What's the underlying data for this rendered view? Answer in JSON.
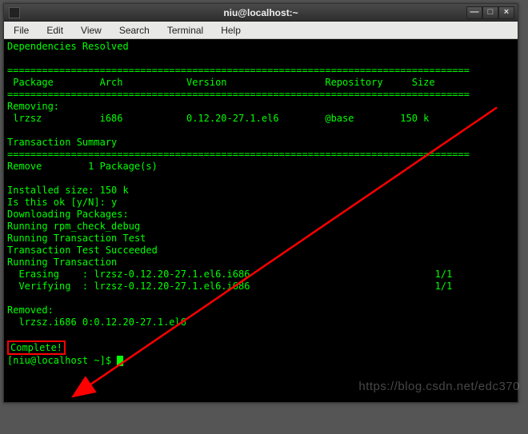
{
  "window": {
    "title": "niu@localhost:~",
    "controls": {
      "min": "—",
      "max": "□",
      "close": "×"
    }
  },
  "menu": {
    "file": "File",
    "edit": "Edit",
    "view": "View",
    "search": "Search",
    "terminal": "Terminal",
    "help": "Help"
  },
  "term": {
    "dep_resolved": "Dependencies Resolved",
    "hdr": " Package        Arch           Version                 Repository     Size",
    "removing": "Removing:",
    "pkg_row": " lrzsz          i686           0.12.20-27.1.el6        @base        150 k",
    "txn_summary": "Transaction Summary",
    "remove_count": "Remove        1 Package(s)",
    "inst_size": "Installed size: 150 k",
    "is_ok": "Is this ok [y/N]: y",
    "dl": "Downloading Packages:",
    "rpm_check": "Running rpm_check_debug",
    "run_txn_test": "Running Transaction Test",
    "txn_test_ok": "Transaction Test Succeeded",
    "run_txn": "Running Transaction",
    "erasing": "  Erasing    : lrzsz-0.12.20-27.1.el6.i686                                1/1",
    "verifying": "  Verifying  : lrzsz-0.12.20-27.1.el6.i686                                1/1",
    "removed": "Removed:",
    "removed_pkg": "  lrzsz.i686 0:0.12.20-27.1.el6",
    "complete": "Complete!",
    "prompt": "[niu@localhost ~]$ "
  },
  "sep": "================================================================================",
  "watermark": "https://blog.csdn.net/edc370"
}
